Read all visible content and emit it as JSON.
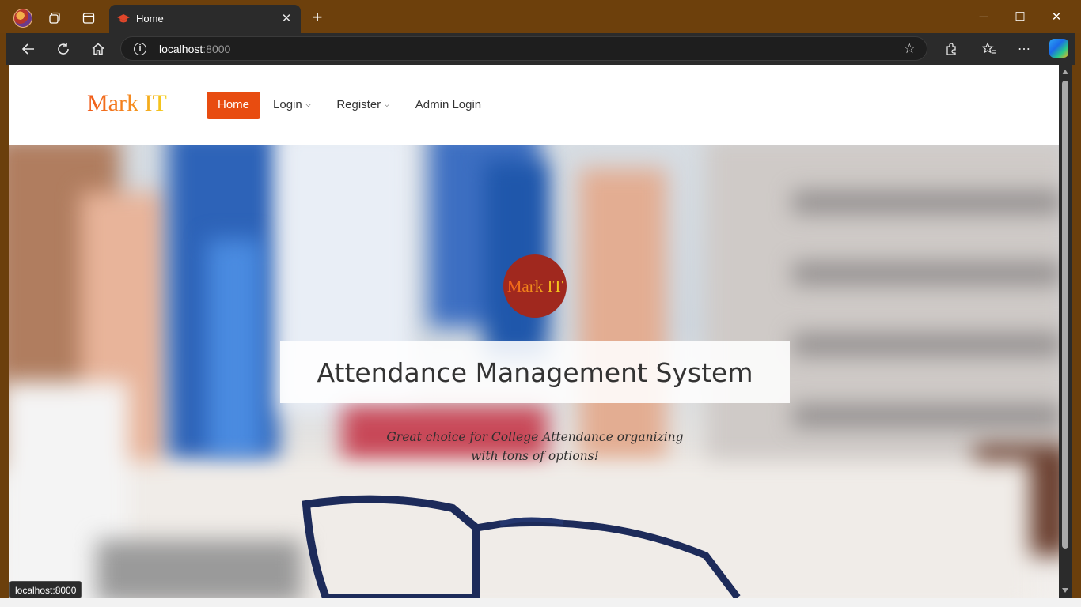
{
  "browser": {
    "tab": {
      "title": "Home",
      "favicon": "graduation-cap-icon"
    },
    "address": {
      "host": "localhost",
      "port": ":8000"
    },
    "status_link": "localhost:8000"
  },
  "site": {
    "logo": "Mark IT",
    "nav": [
      {
        "label": "Home",
        "active": true
      },
      {
        "label": "Login",
        "dropdown": true
      },
      {
        "label": "Register",
        "dropdown": true
      },
      {
        "label": "Admin Login"
      }
    ],
    "hero": {
      "badge": "Mark IT",
      "title": "Attendance Management System",
      "subtitle_line1": "Great choice for College Attendance organizing",
      "subtitle_line2": "with tons of options!"
    }
  },
  "colors": {
    "accent": "#e84c10",
    "badge": "#a0281e",
    "titlebar": "#6d400c"
  }
}
